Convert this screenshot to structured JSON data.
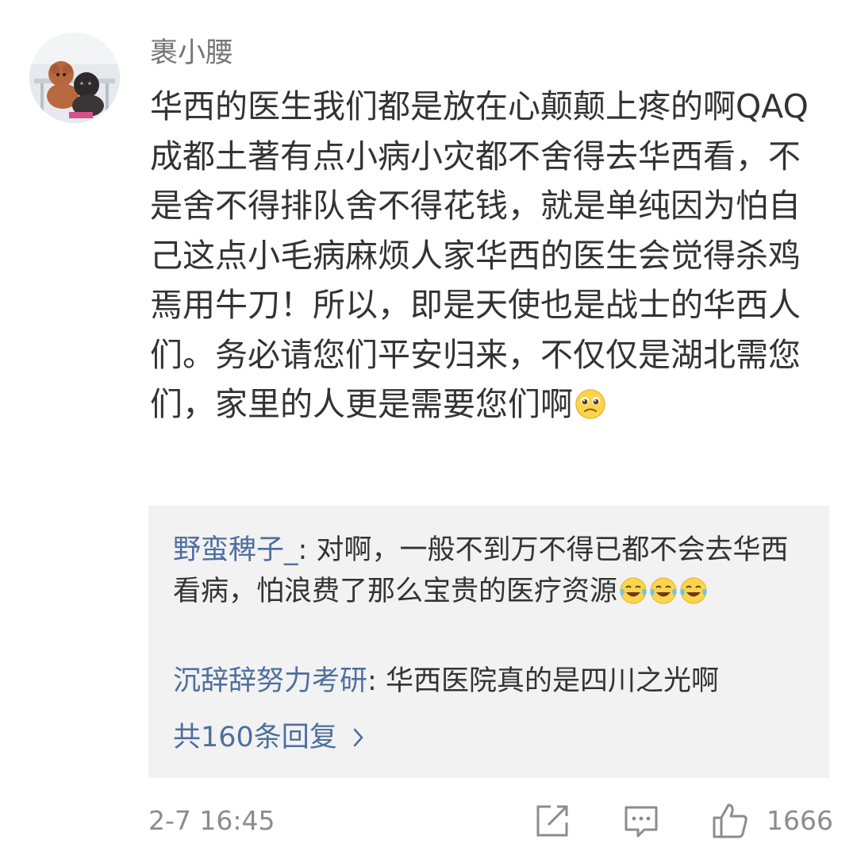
{
  "comment": {
    "username": "裹小腰",
    "text": "华西的医生我们都是放在心颠颠上疼的啊QAQ成都土著有点小病小灾都不舍得去华西看，不是舍不得排队舍不得花钱，就是单纯因为怕自己这点小毛病麻烦人家华西的医生会觉得杀鸡焉用牛刀！所以，即是天使也是战士的华西人们。务必请您们平安归来，不仅仅是湖北需您们，家里的人更是需要您们啊",
    "emoji": "pleading-face-icon"
  },
  "replies": [
    {
      "user": "野蛮稗子_",
      "separator": ": ",
      "text": "对啊，一般不到万不得已都不会去华西看病，怕浪费了那么宝贵的医疗资源",
      "emojis": [
        "crying-laughing-icon",
        "crying-laughing-icon",
        "crying-laughing-icon"
      ]
    },
    {
      "user": "沉辞辞努力考研",
      "separator": ": ",
      "text": "华西医院真的是四川之光啊"
    }
  ],
  "more_replies": "共160条回复",
  "meta": {
    "time": "2-7 16:45",
    "like_count": "1666"
  },
  "colors": {
    "link": "#4e6f9e",
    "muted": "#8c8c8c",
    "reply_bg": "#f2f2f2"
  }
}
